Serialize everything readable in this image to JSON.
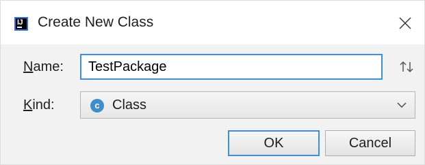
{
  "window": {
    "title": "Create New Class",
    "logo_icon": "intellij-logo-icon",
    "logo_text": "IJ",
    "close_icon": "close-icon"
  },
  "form": {
    "name_label_mnemonic": "N",
    "name_label_rest": "ame:",
    "name_value": "TestPackage",
    "sort_icon": "sort-arrows-icon",
    "kind_label_mnemonic": "K",
    "kind_label_rest": "ind:",
    "kind_icon": "class-icon",
    "kind_icon_letter": "c",
    "kind_value": "Class",
    "kind_dropdown_icon": "chevron-down-icon"
  },
  "buttons": {
    "ok_label": "OK",
    "cancel_label": "Cancel"
  },
  "colors": {
    "focus_accent": "#3c8fde",
    "class_icon": "#3e8fc9",
    "dialog_background": "#f2f2f2"
  }
}
